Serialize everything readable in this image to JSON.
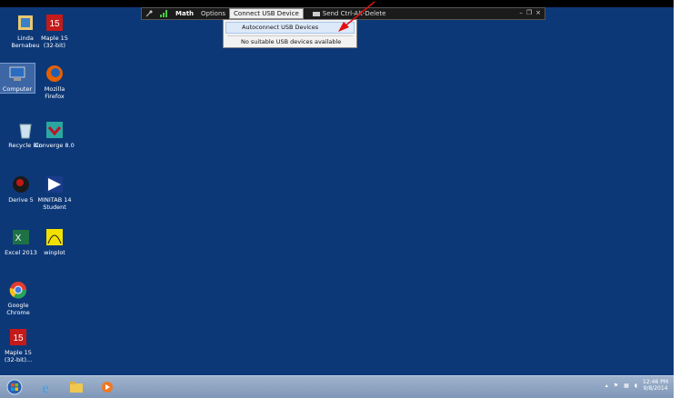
{
  "desktop": {
    "background": "#0d3878",
    "icons": [
      {
        "label": "Linda\nBernabeu",
        "name": "linda-bernabeu"
      },
      {
        "label": "Maple 15\n(32-bit)",
        "name": "maple-15-32bit"
      },
      {
        "label": "Computer",
        "name": "computer"
      },
      {
        "label": "Mozilla\nFirefox",
        "name": "mozilla-firefox"
      },
      {
        "label": "Recycle Bin",
        "name": "recycle-bin"
      },
      {
        "label": "Converge 8.0",
        "name": "converge-8"
      },
      {
        "label": "Derive 5",
        "name": "derive-5"
      },
      {
        "label": "MINITAB 14\nStudent",
        "name": "minitab-14-student"
      },
      {
        "label": "Excel 2013",
        "name": "excel-2013"
      },
      {
        "label": "winplot",
        "name": "winplot"
      },
      {
        "label": "Google\nChrome",
        "name": "google-chrome"
      },
      {
        "label": "Maple 15\n(32-bit)...",
        "name": "maple-15-32bit-shortcut"
      }
    ]
  },
  "remote_toolbar": {
    "title": "Math",
    "options": "Options",
    "connect_usb": "Connect USB Device",
    "send_cad": "Send Ctrl-Alt-Delete",
    "minimize": "–",
    "restore": "❐",
    "close": "×"
  },
  "usb_menu": {
    "items": [
      "Autoconnect USB Devices",
      "No suitable USB devices available"
    ]
  },
  "taskbar": {
    "clock_time": "12:46 PM",
    "clock_date": "9/8/2014"
  },
  "colors": {
    "accent_arrow": "#e01010",
    "taskbar": "#8fa6c4"
  }
}
